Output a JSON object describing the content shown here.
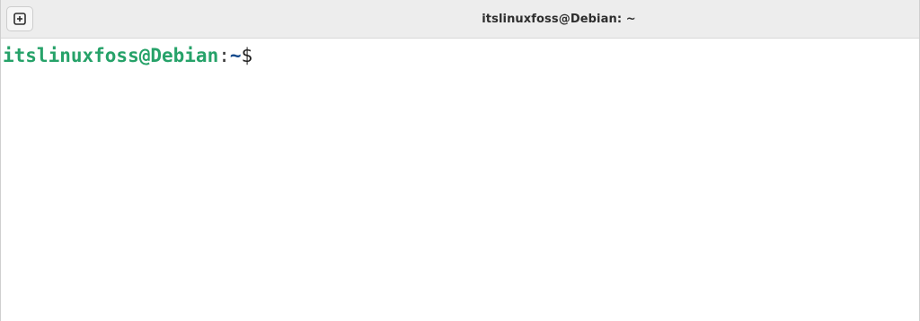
{
  "window": {
    "title": "itslinuxfoss@Debian: ~"
  },
  "toolbar": {
    "new_tab_icon": "plus-square-icon"
  },
  "terminal": {
    "prompt": {
      "user_host": "itslinuxfoss@Debian",
      "separator": ":",
      "directory": "~",
      "symbol": "$"
    }
  },
  "colors": {
    "user_host": "#26a269",
    "directory": "#12488b",
    "titlebar_bg": "#ededed"
  }
}
